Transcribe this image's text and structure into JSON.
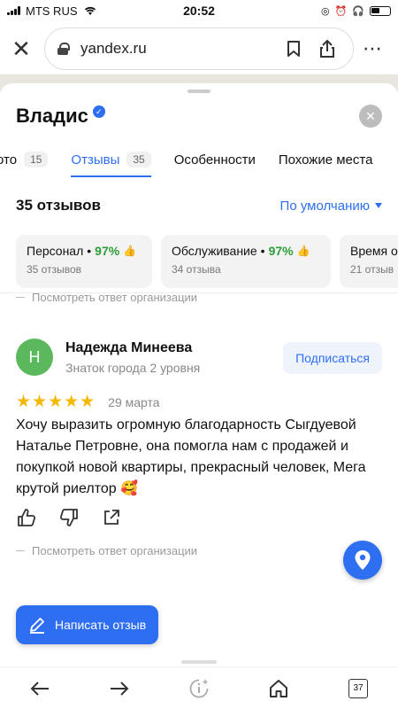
{
  "status": {
    "carrier": "MTS RUS",
    "time": "20:52"
  },
  "browser": {
    "url": "yandex.ru",
    "tabs_count": "37"
  },
  "org": {
    "title": "Владис"
  },
  "tabs": [
    {
      "label": "Фото",
      "display": "ото",
      "count": "15"
    },
    {
      "label": "Отзывы",
      "count": "35"
    },
    {
      "label": "Особенности"
    },
    {
      "label": "Похожие места"
    }
  ],
  "reviews_header": {
    "count_title": "35 отзывов",
    "sort_label": "По умолчанию"
  },
  "aspects": [
    {
      "name": "Персонал",
      "percent": "97%",
      "reviews": "35 отзывов"
    },
    {
      "name": "Обслуживание",
      "percent": "97%",
      "reviews": "34 отзыва"
    },
    {
      "name": "Время о",
      "reviews": "21 отзыв"
    }
  ],
  "owner_reply_label": "Посмотреть ответ организации",
  "review": {
    "avatar_letter": "Н",
    "author": "Надежда Минеева",
    "level": "Знаток города 2 уровня",
    "subscribe_label": "Подписаться",
    "rating": 5,
    "stars": "★★★★★",
    "date": "29 марта",
    "text": "Хочу выразить огромную благодарность Сыгдуевой Наталье Петровне, она помогла нам с продажей и покупкой новой квартиры, прекрасный человек, Мега крутой риелтор 🥰"
  },
  "write_review_label": "Написать отзыв",
  "colors": {
    "accent": "#2e6ff2",
    "positive": "#2d9c3a",
    "star": "#f5b800",
    "avatar": "#5cb85c"
  },
  "icons": [
    "wifi-icon",
    "lock-icon",
    "bookmark-icon",
    "share-icon",
    "close-icon",
    "verified-icon",
    "thumb-up-icon",
    "like-icon",
    "dislike-icon",
    "share-review-icon",
    "location-pin-icon",
    "pencil-icon",
    "back-arrow-icon",
    "forward-arrow-icon",
    "assistant-icon",
    "home-icon",
    "tabs-icon"
  ]
}
